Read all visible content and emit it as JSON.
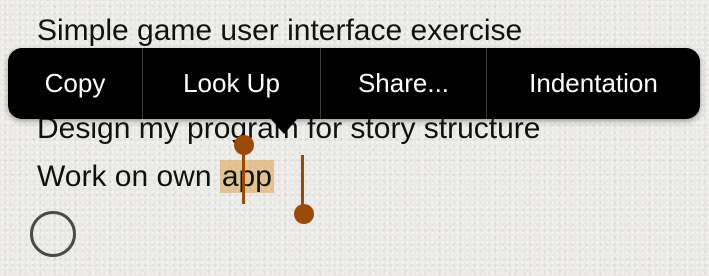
{
  "lines": {
    "line1": "Simple game user interface exercise",
    "line2": "Design my program for story structure",
    "line3_prefix": "Work on own ",
    "line3_selected": "app"
  },
  "context_menu": {
    "items": [
      "Copy",
      "Look Up",
      "Share...",
      "Indentation"
    ]
  },
  "colors": {
    "selection_highlight": "#dcaa5a",
    "selection_handle": "#9a4a05",
    "menu_background": "#000000",
    "menu_text": "#ffffff"
  }
}
